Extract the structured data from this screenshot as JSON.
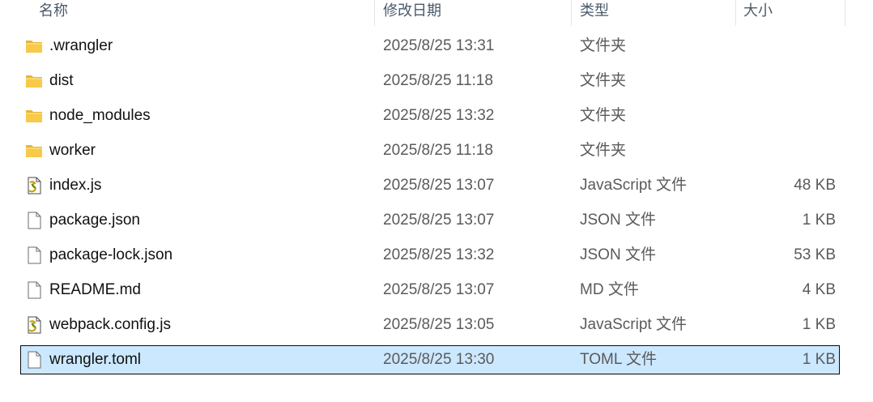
{
  "columns": {
    "name": "名称",
    "date": "修改日期",
    "type": "类型",
    "size": "大小"
  },
  "files": [
    {
      "name": ".wrangler",
      "date": "2025/8/25 13:31",
      "type": "文件夹",
      "size": "",
      "icon": "folder-icon"
    },
    {
      "name": "dist",
      "date": "2025/8/25 11:18",
      "type": "文件夹",
      "size": "",
      "icon": "folder-icon"
    },
    {
      "name": "node_modules",
      "date": "2025/8/25 13:32",
      "type": "文件夹",
      "size": "",
      "icon": "folder-icon"
    },
    {
      "name": "worker",
      "date": "2025/8/25 11:18",
      "type": "文件夹",
      "size": "",
      "icon": "folder-icon"
    },
    {
      "name": "index.js",
      "date": "2025/8/25 13:07",
      "type": "JavaScript 文件",
      "size": "48 KB",
      "icon": "js-file-icon"
    },
    {
      "name": "package.json",
      "date": "2025/8/25 13:07",
      "type": "JSON 文件",
      "size": "1 KB",
      "icon": "file-icon"
    },
    {
      "name": "package-lock.json",
      "date": "2025/8/25 13:32",
      "type": "JSON 文件",
      "size": "53 KB",
      "icon": "file-icon"
    },
    {
      "name": "README.md",
      "date": "2025/8/25 13:07",
      "type": "MD 文件",
      "size": "4 KB",
      "icon": "file-icon"
    },
    {
      "name": "webpack.config.js",
      "date": "2025/8/25 13:05",
      "type": "JavaScript 文件",
      "size": "1 KB",
      "icon": "js-file-icon"
    },
    {
      "name": "wrangler.toml",
      "date": "2025/8/25 13:30",
      "type": "TOML 文件",
      "size": "1 KB",
      "icon": "file-icon",
      "selected": true
    }
  ],
  "colors": {
    "selection": "#cce8ff",
    "folder": "#f8c94a",
    "header_text": "#4a5a6a"
  }
}
